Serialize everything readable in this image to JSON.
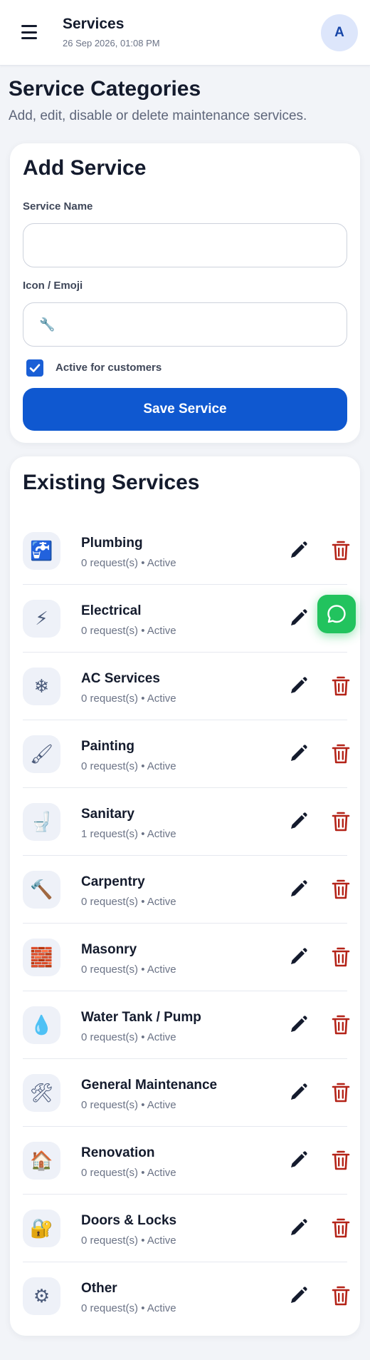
{
  "header": {
    "title": "Services",
    "datetime": "26 Sep 2026, 01:08 PM",
    "avatar_initial": "A"
  },
  "page": {
    "title": "Service Categories",
    "description": "Add, edit, disable or delete maintenance services."
  },
  "add_service": {
    "title": "Add Service",
    "name_label": "Service Name",
    "name_value": "",
    "icon_label": "Icon / Emoji",
    "icon_placeholder": "🔧",
    "active_checked": true,
    "active_label": "Active for customers",
    "save_label": "Save Service"
  },
  "existing": {
    "title": "Existing Services",
    "services": [
      {
        "name": "Plumbing",
        "meta": "0 request(s) • Active",
        "icon": "🚰"
      },
      {
        "name": "Electrical",
        "meta": "0 request(s) • Active",
        "icon": "⚡"
      },
      {
        "name": "AC Services",
        "meta": "0 request(s) • Active",
        "icon": "❄"
      },
      {
        "name": "Painting",
        "meta": "0 request(s) • Active",
        "icon": "🖌"
      },
      {
        "name": "Sanitary",
        "meta": "1 request(s) • Active",
        "icon": "🚽"
      },
      {
        "name": "Carpentry",
        "meta": "0 request(s) • Active",
        "icon": "🔨"
      },
      {
        "name": "Masonry",
        "meta": "0 request(s) • Active",
        "icon": "🧱"
      },
      {
        "name": "Water Tank / Pump",
        "meta": "0 request(s) • Active",
        "icon": "💧"
      },
      {
        "name": "General Maintenance",
        "meta": "0 request(s) • Active",
        "icon": "🛠"
      },
      {
        "name": "Renovation",
        "meta": "0 request(s) • Active",
        "icon": "🏠"
      },
      {
        "name": "Doors & Locks",
        "meta": "0 request(s) • Active",
        "icon": "🔐"
      },
      {
        "name": "Other",
        "meta": "0 request(s) • Active",
        "icon": "⚙"
      }
    ]
  },
  "colors": {
    "primary": "#0f58d0",
    "delete": "#b42318",
    "whatsapp": "#22c35e",
    "background": "#f2f4f8"
  }
}
